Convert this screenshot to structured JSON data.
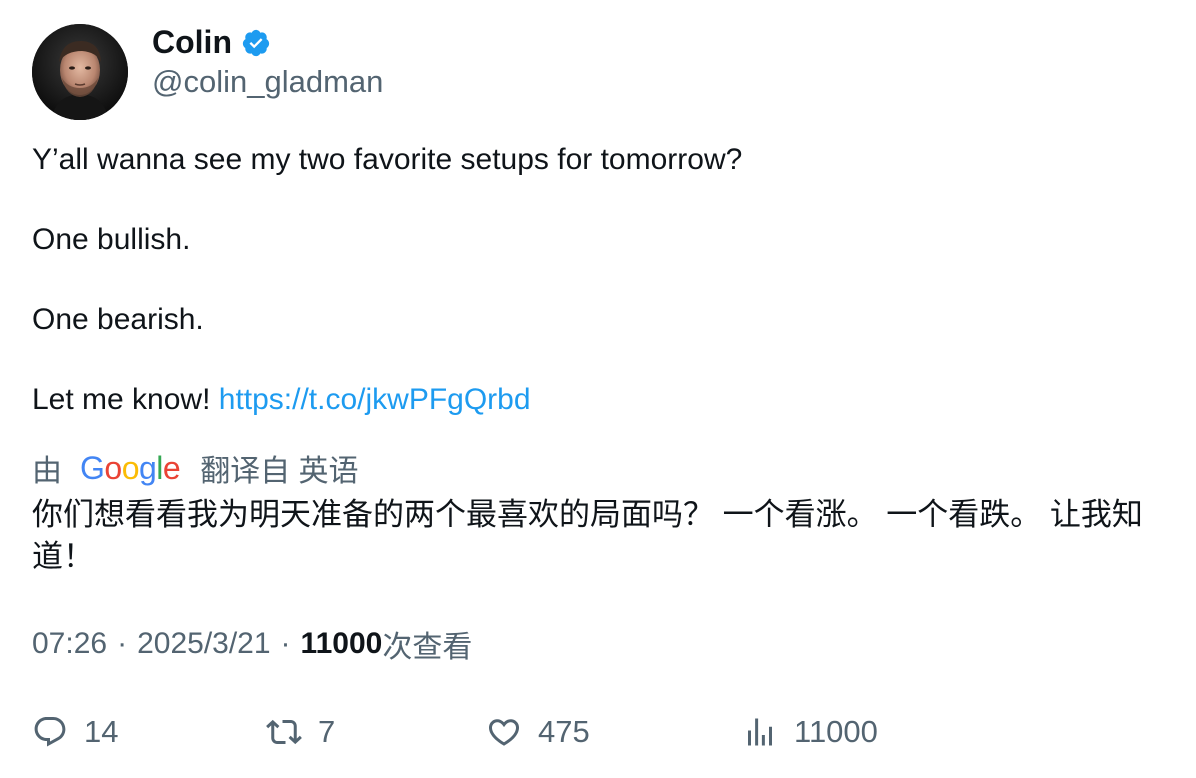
{
  "author": {
    "display_name": "Colin",
    "handle": "@colin_gladman",
    "verified": true,
    "verified_color": "#1d9bf0",
    "avatar_icon": "profile-photo"
  },
  "tweet": {
    "paragraphs": [
      "Y’all wanna see my two favorite setups for tomorrow?",
      "One bullish.",
      "One bearish."
    ],
    "last_line_text": "Let me know!",
    "link": "https://t.co/jkwPFgQrbd",
    "link_color": "#1d9bf0"
  },
  "translation": {
    "by_label": "由",
    "provider_letters": [
      "G",
      "o",
      "o",
      "g",
      "l",
      "e"
    ],
    "provider_colors": [
      "#4285f4",
      "#ea4335",
      "#fbbc05",
      "#4285f4",
      "#34a853",
      "#ea4335"
    ],
    "from_label": "翻译自 英语",
    "text": "你们想看看我为明天准备的两个最喜欢的局面吗？ 一个看涨。 一个看跌。 让我知道！"
  },
  "meta": {
    "time": "07:26",
    "separator": "·",
    "date": "2025/3/21",
    "views_count": "11000",
    "views_label": "次查看"
  },
  "actions": {
    "reply": {
      "icon": "reply-icon",
      "count": "14"
    },
    "retweet": {
      "icon": "retweet-icon",
      "count": "7"
    },
    "like": {
      "icon": "heart-icon",
      "count": "475"
    },
    "views": {
      "icon": "analytics-icon",
      "count": "11000"
    }
  },
  "colors": {
    "primary_text": "#0f1419",
    "secondary_text": "#536471"
  }
}
